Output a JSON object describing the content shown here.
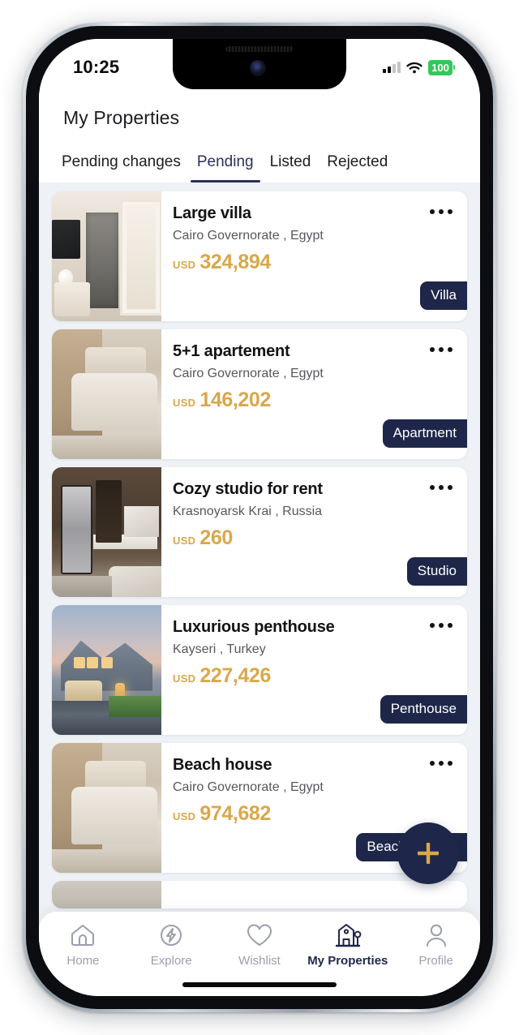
{
  "status_bar": {
    "time": "10:25",
    "battery_percent": "100",
    "battery_color": "#34c759",
    "signal_icon": "cellular-signal-icon",
    "wifi_icon": "wifi-icon"
  },
  "header": {
    "title": "My Properties"
  },
  "tabs": [
    {
      "label": "Pending changes",
      "active": false
    },
    {
      "label": "Pending",
      "active": true
    },
    {
      "label": "Listed",
      "active": false
    },
    {
      "label": "Rejected",
      "active": false
    }
  ],
  "theme": {
    "navy": "#1e2749",
    "tab_active": "#2a3158",
    "gold": "#d9a84b",
    "list_bg": "#eef1f5",
    "card_bg": "#ffffff"
  },
  "properties": [
    {
      "title": "Large villa",
      "location": "Cairo Governorate , Egypt",
      "currency": "USD",
      "price": "324,894",
      "badge": "Villa",
      "photo": "interior-hallway-photo",
      "menu_icon": "more-options-icon"
    },
    {
      "title": "5+1 apartement",
      "location": "Cairo Governorate , Egypt",
      "currency": "USD",
      "price": "146,202",
      "badge": "Apartment",
      "photo": "bedroom-interior-photo",
      "menu_icon": "more-options-icon"
    },
    {
      "title": "Cozy studio for rent",
      "location": "Krasnoyarsk Krai , Russia",
      "currency": "USD",
      "price": "260",
      "badge": "Studio",
      "photo": "kitchen-interior-photo",
      "menu_icon": "more-options-icon"
    },
    {
      "title": "Luxurious penthouse",
      "location": "Kayseri , Turkey",
      "currency": "USD",
      "price": "227,426",
      "badge": "Penthouse",
      "photo": "house-exterior-dusk-photo",
      "menu_icon": "more-options-icon"
    },
    {
      "title": "Beach house",
      "location": "Cairo Governorate , Egypt",
      "currency": "USD",
      "price": "974,682",
      "badge": "Beach Houses",
      "photo": "bedroom-interior-photo",
      "menu_icon": "more-options-icon"
    }
  ],
  "fab": {
    "icon": "plus-icon",
    "label": "Add property"
  },
  "bottom_nav": [
    {
      "label": "Home",
      "icon": "home-icon",
      "active": false
    },
    {
      "label": "Explore",
      "icon": "explore-bolt-icon",
      "active": false
    },
    {
      "label": "Wishlist",
      "icon": "heart-icon",
      "active": false
    },
    {
      "label": "My Properties",
      "icon": "properties-icon",
      "active": true
    },
    {
      "label": "Profile",
      "icon": "person-icon",
      "active": false
    }
  ]
}
